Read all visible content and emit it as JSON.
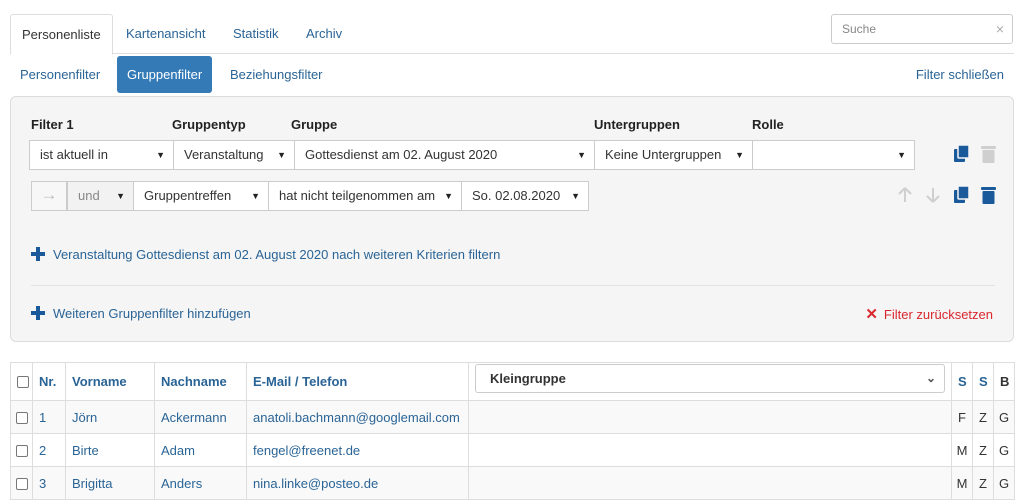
{
  "tabs": [
    "Personenliste",
    "Kartenansicht",
    "Statistik",
    "Archiv"
  ],
  "search": {
    "placeholder": "Suche",
    "clear": "×"
  },
  "subnav": {
    "items": [
      "Personenfilter",
      "Gruppenfilter",
      "Beziehungsfilter"
    ],
    "close": "Filter schließen"
  },
  "filter": {
    "headers": {
      "filter": "Filter 1",
      "gruppentyp": "Gruppentyp",
      "gruppe": "Gruppe",
      "untergruppen": "Untergruppen",
      "rolle": "Rolle"
    },
    "row1": {
      "status": "ist aktuell in",
      "gruppentyp": "Veranstaltung",
      "gruppe": "Gottesdienst am 02. August 2020",
      "untergruppen": "Keine Untergruppen",
      "rolle": ""
    },
    "row2": {
      "arrow": "→",
      "logic": "und",
      "typ": "Gruppentreffen",
      "bedingung": "hat nicht teilgenommen am",
      "datum": "So. 02.08.2020"
    },
    "add_criteria": "Veranstaltung Gottesdienst am 02. August 2020 nach weiteren Kriterien filtern",
    "add_group_filter": "Weiteren Gruppenfilter hinzufügen",
    "reset": "Filter zurücksetzen"
  },
  "table": {
    "headers": {
      "nr": "Nr.",
      "vorname": "Vorname",
      "nachname": "Nachname",
      "email": "E-Mail / Telefon",
      "kleingruppe": "Kleingruppe",
      "s1": "S",
      "s2": "S",
      "b": "B"
    },
    "rows": [
      {
        "nr": "1",
        "vorname": "Jörn",
        "nachname": "Ackermann",
        "email": "anatoli.bachmann@googlemail.com",
        "s1": "F",
        "s2": "Z",
        "b": "G"
      },
      {
        "nr": "2",
        "vorname": "Birte",
        "nachname": "Adam",
        "email": "fengel@freenet.de",
        "s1": "M",
        "s2": "Z",
        "b": "G"
      },
      {
        "nr": "3",
        "vorname": "Brigitta",
        "nachname": "Anders",
        "email": "nina.linke@posteo.de",
        "s1": "M",
        "s2": "Z",
        "b": "G"
      }
    ]
  },
  "colors": {
    "link": "#2a6496",
    "primary": "#337ab7",
    "danger": "#d9272e",
    "icon": "#1a5a9a"
  }
}
